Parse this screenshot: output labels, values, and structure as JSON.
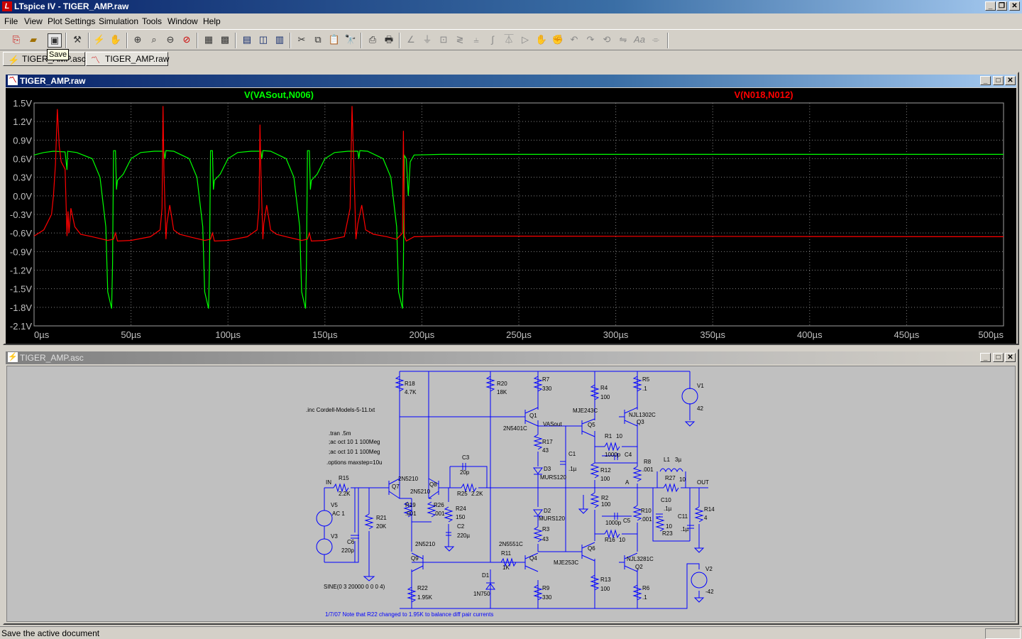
{
  "app": {
    "title": "LTspice IV - TIGER_AMP.raw"
  },
  "menu": [
    "File",
    "View",
    "Plot Settings",
    "Simulation",
    "Tools",
    "Window",
    "Help"
  ],
  "toolbar": {
    "tooltip": "Save",
    "icons": [
      "new-schematic-icon",
      "open-icon",
      "save-icon",
      "control-panel-icon",
      "run-icon",
      "halt-icon",
      "zoom-in-icon",
      "zoom-full-icon",
      "zoom-out-icon",
      "zoom-cancel-icon",
      "autorange-icon",
      "delete-trace-icon",
      "tile-vertical-icon",
      "cascade-icon",
      "tile-horizontal-icon",
      "cut-icon",
      "copy-icon",
      "paste-icon",
      "find-icon",
      "print-preview-icon",
      "print-icon",
      "wire-icon",
      "ground-icon",
      "label-net-icon",
      "resistor-icon",
      "capacitor-icon",
      "inductor-icon",
      "diode-icon",
      "component-icon",
      "move-icon",
      "drag-icon",
      "undo-icon",
      "redo-icon",
      "rotate-icon",
      "mirror-icon",
      "text-icon",
      "spice-directive-icon"
    ]
  },
  "tabs": [
    {
      "label": "TIGER_AMP.asc",
      "icon": "schematic-icon"
    },
    {
      "label": "TIGER_AMP.raw",
      "icon": "waveform-icon"
    }
  ],
  "plot_window": {
    "title": "TIGER_AMP.raw"
  },
  "schematic_window": {
    "title": "TIGER_AMP.asc"
  },
  "status": {
    "text": "Save the active document"
  },
  "colors": {
    "trace1": "#00ff00",
    "trace2": "#ff0000",
    "grid": "#808080",
    "background": "#000000",
    "wire": "#0000ff"
  },
  "chart_data": {
    "type": "line",
    "title": "",
    "xlabel": "",
    "ylabel": "",
    "x_ticks": [
      "0µs",
      "50µs",
      "100µs",
      "150µs",
      "200µs",
      "250µs",
      "300µs",
      "350µs",
      "400µs",
      "450µs",
      "500µs"
    ],
    "y_ticks": [
      "1.5V",
      "1.2V",
      "0.9V",
      "0.6V",
      "0.3V",
      "0.0V",
      "-0.3V",
      "-0.6V",
      "-0.9V",
      "-1.2V",
      "-1.5V",
      "-1.8V",
      "-2.1V"
    ],
    "xlim": [
      0,
      500
    ],
    "ylim": [
      -2.1,
      1.5
    ],
    "grid": true,
    "series": [
      {
        "name": "V(VASout,N006)",
        "color": "#00ff00",
        "points": [
          [
            0,
            0.66
          ],
          [
            5,
            0.7
          ],
          [
            10,
            0.72
          ],
          [
            16,
            0.71
          ],
          [
            17,
            0.42
          ],
          [
            17.3,
            0.72
          ],
          [
            22,
            0.7
          ],
          [
            30,
            0.6
          ],
          [
            34,
            0.3
          ],
          [
            37,
            -0.5
          ],
          [
            38,
            -1.55
          ],
          [
            40,
            -1.82
          ],
          [
            40.5,
            -1.1
          ],
          [
            41,
            0.73
          ],
          [
            42,
            0.73
          ],
          [
            42.5,
            0.1
          ],
          [
            43,
            0.25
          ],
          [
            46,
            0.35
          ],
          [
            50,
            0.6
          ],
          [
            55,
            0.7
          ],
          [
            62,
            0.72
          ],
          [
            67,
            0.72
          ],
          [
            67.5,
            0.6
          ],
          [
            68,
            0.73
          ],
          [
            72,
            0.72
          ],
          [
            80,
            0.6
          ],
          [
            84,
            0.3
          ],
          [
            87,
            -0.5
          ],
          [
            88,
            -1.55
          ],
          [
            90,
            -1.82
          ],
          [
            90.5,
            -1.1
          ],
          [
            91,
            0.73
          ],
          [
            92,
            0.73
          ],
          [
            92.5,
            0.1
          ],
          [
            93,
            0.25
          ],
          [
            96,
            0.35
          ],
          [
            100,
            0.6
          ],
          [
            105,
            0.7
          ],
          [
            112,
            0.72
          ],
          [
            117,
            0.72
          ],
          [
            117.5,
            0.6
          ],
          [
            118,
            0.73
          ],
          [
            122,
            0.72
          ],
          [
            130,
            0.6
          ],
          [
            134,
            0.3
          ],
          [
            137,
            -0.5
          ],
          [
            138,
            -1.55
          ],
          [
            140,
            -1.82
          ],
          [
            140.5,
            -1.1
          ],
          [
            141,
            0.73
          ],
          [
            142,
            0.73
          ],
          [
            142.5,
            0.1
          ],
          [
            143,
            0.25
          ],
          [
            146,
            0.35
          ],
          [
            150,
            0.6
          ],
          [
            155,
            0.7
          ],
          [
            162,
            0.72
          ],
          [
            167,
            0.72
          ],
          [
            167.5,
            0.6
          ],
          [
            168,
            0.73
          ],
          [
            172,
            0.72
          ],
          [
            180,
            0.6
          ],
          [
            184,
            0.3
          ],
          [
            187,
            -0.5
          ],
          [
            188,
            -1.55
          ],
          [
            190,
            -1.82
          ],
          [
            190.5,
            -1.1
          ],
          [
            191,
            0.65
          ],
          [
            192,
            0.6
          ],
          [
            193,
            0.0
          ],
          [
            194,
            0.55
          ],
          [
            196,
            0.66
          ],
          [
            210,
            0.67
          ],
          [
            500,
            0.67
          ]
        ]
      },
      {
        "name": "V(N018,N012)",
        "color": "#ff0000",
        "points": [
          [
            0,
            -0.65
          ],
          [
            5,
            -0.55
          ],
          [
            9,
            -0.3
          ],
          [
            10,
            0.0
          ],
          [
            11,
            0.5
          ],
          [
            12,
            1.4
          ],
          [
            13,
            0.8
          ],
          [
            14,
            0.55
          ],
          [
            16,
            0.43
          ],
          [
            17,
            -0.65
          ],
          [
            17.5,
            -0.25
          ],
          [
            18,
            -0.6
          ],
          [
            19,
            -0.2
          ],
          [
            21,
            -0.5
          ],
          [
            24,
            -0.62
          ],
          [
            30,
            -0.66
          ],
          [
            38,
            -0.72
          ],
          [
            41,
            -0.7
          ],
          [
            42,
            -0.6
          ],
          [
            43,
            -0.73
          ],
          [
            50,
            -0.72
          ],
          [
            60,
            -0.66
          ],
          [
            65,
            -0.55
          ],
          [
            66,
            -0.2
          ],
          [
            66.5,
            1.45
          ],
          [
            67,
            0.4
          ],
          [
            68,
            -0.7
          ],
          [
            68.5,
            -0.45
          ],
          [
            70,
            -0.15
          ],
          [
            72,
            -0.55
          ],
          [
            75,
            -0.62
          ],
          [
            80,
            -0.66
          ],
          [
            88,
            -0.72
          ],
          [
            91,
            -0.7
          ],
          [
            92,
            -0.6
          ],
          [
            93,
            -0.73
          ],
          [
            100,
            -0.72
          ],
          [
            110,
            -0.66
          ],
          [
            115,
            -0.55
          ],
          [
            116,
            -0.2
          ],
          [
            116.5,
            1.15
          ],
          [
            117,
            0.4
          ],
          [
            118,
            -0.7
          ],
          [
            118.5,
            -0.45
          ],
          [
            120,
            -0.15
          ],
          [
            122,
            -0.55
          ],
          [
            125,
            -0.62
          ],
          [
            130,
            -0.66
          ],
          [
            138,
            -0.72
          ],
          [
            141,
            -0.7
          ],
          [
            142,
            -0.6
          ],
          [
            143,
            -0.73
          ],
          [
            150,
            -0.72
          ],
          [
            160,
            -0.66
          ],
          [
            163,
            -0.2
          ],
          [
            164,
            1.45
          ],
          [
            165,
            0.4
          ],
          [
            166,
            -0.7
          ],
          [
            167,
            -0.45
          ],
          [
            169,
            -0.15
          ],
          [
            171,
            -0.55
          ],
          [
            175,
            -0.62
          ],
          [
            182,
            -0.66
          ],
          [
            187,
            -0.7
          ],
          [
            190,
            -0.6
          ],
          [
            190.5,
            1.05
          ],
          [
            191,
            -0.65
          ],
          [
            192,
            -0.73
          ],
          [
            196,
            -0.66
          ],
          [
            210,
            -0.65
          ],
          [
            500,
            -0.66
          ]
        ]
      }
    ]
  },
  "schematic": {
    "directives": [
      ".inc Cordell-Models-5-11.txt",
      ".tran .5m",
      ";ac oct 10 1 100Meg",
      ";ac oct 10 1 100Meg",
      ".options maxstep=10u"
    ],
    "source_expr": "SINE(0 3 20000 0 0 0 4)",
    "note": "1/7/07  Note that R22 changed to 1.95K to balance diff pair currents",
    "labels": [
      [
        "R18",
        570,
        541
      ],
      [
        "4.7K",
        570,
        553
      ],
      [
        "R20",
        700,
        541
      ],
      [
        "18K",
        700,
        553
      ],
      [
        "R7",
        764,
        535
      ],
      [
        "330",
        764,
        548
      ],
      [
        "R4",
        846,
        547
      ],
      [
        "100",
        846,
        560
      ],
      [
        "R5",
        905,
        535
      ],
      [
        ".1",
        905,
        548
      ],
      [
        "V1",
        982,
        544
      ],
      [
        "42",
        982,
        576
      ],
      [
        "Q1",
        746,
        586
      ],
      [
        "2N5401C",
        709,
        604
      ],
      [
        "VASout",
        765,
        598
      ],
      [
        "MJE243C",
        807,
        579
      ],
      [
        "Q5",
        828,
        599
      ],
      [
        "NJL1302C",
        886,
        585
      ],
      [
        "Q3",
        897,
        595
      ],
      [
        "R1",
        852,
        615
      ],
      [
        "10",
        868,
        615
      ],
      [
        "R17",
        764,
        623
      ],
      [
        "43",
        764,
        635
      ],
      [
        "C1",
        801,
        640
      ],
      [
        ".1µ",
        801,
        661
      ],
      [
        "1000p",
        852,
        641
      ],
      [
        "C4",
        880,
        641
      ],
      [
        "R8",
        907,
        651
      ],
      [
        ".001",
        905,
        662
      ],
      [
        "D3",
        766,
        661
      ],
      [
        "MURS120",
        761,
        673
      ],
      [
        "R12",
        846,
        663
      ],
      [
        "100",
        846,
        675
      ],
      [
        "A",
        881,
        680
      ],
      [
        "C3",
        651,
        645
      ],
      [
        "20p",
        648,
        666
      ],
      [
        "L1",
        935,
        648
      ],
      [
        "3µ",
        951,
        648
      ],
      [
        "R27",
        937,
        674
      ],
      [
        "10",
        957,
        676
      ],
      [
        "OUT",
        982,
        680
      ],
      [
        "IN",
        459,
        680
      ],
      [
        "R15",
        477,
        674
      ],
      [
        "2.2K",
        477,
        696
      ],
      [
        "2N5210",
        561,
        675
      ],
      [
        "Q7",
        552,
        686
      ],
      [
        "2N5210",
        578,
        693
      ],
      [
        "Q8",
        605,
        683
      ],
      [
        "R25",
        644,
        696
      ],
      [
        "2.2K",
        664,
        696
      ],
      [
        "R2",
        847,
        702
      ],
      [
        "100",
        847,
        711
      ],
      [
        "C10",
        931,
        705
      ],
      [
        ".1µ",
        935,
        717
      ],
      [
        "R14",
        992,
        718
      ],
      [
        "4",
        992,
        730
      ],
      [
        "V5",
        466,
        712
      ],
      [
        "AC 1",
        468,
        724
      ],
      [
        "R19",
        571,
        712
      ],
      [
        ".001",
        571,
        724
      ],
      [
        "R26",
        611,
        712
      ],
      [
        ".001",
        611,
        724
      ],
      [
        "R24",
        642,
        717
      ],
      [
        "150",
        642,
        729
      ],
      [
        "D2",
        766,
        720
      ],
      [
        "MURS120",
        759,
        731
      ],
      [
        "R10",
        903,
        720
      ],
      [
        ".001",
        903,
        732
      ],
      [
        "C5",
        878,
        734
      ],
      [
        "1000p",
        853,
        737
      ],
      [
        "C11",
        955,
        728
      ],
      [
        ".1µ",
        959,
        746
      ],
      [
        "R21",
        530,
        730
      ],
      [
        "20K",
        530,
        742
      ],
      [
        "C2",
        644,
        742
      ],
      [
        "220µ",
        644,
        755
      ],
      [
        "R3",
        764,
        746
      ],
      [
        "43",
        764,
        760
      ],
      [
        "R16",
        852,
        761
      ],
      [
        "10",
        872,
        761
      ],
      [
        "R23",
        933,
        752
      ],
      [
        "V3",
        466,
        756
      ],
      [
        "C6",
        489,
        764
      ],
      [
        "220p",
        481,
        776
      ],
      [
        "2N5210",
        585,
        767
      ],
      [
        "2N5551C",
        703,
        767
      ],
      [
        "R11",
        706,
        780
      ],
      [
        "1K",
        708,
        800
      ],
      [
        "Q4",
        746,
        787
      ],
      [
        "MJE253C",
        780,
        793
      ],
      [
        "Q6",
        828,
        773
      ],
      [
        "NJL3281C",
        883,
        788
      ],
      [
        "Q2",
        895,
        799
      ],
      [
        "V2",
        994,
        802
      ],
      [
        "-42",
        994,
        834
      ],
      [
        "Q9",
        579,
        787
      ],
      [
        "D1",
        679,
        811
      ],
      [
        "R13",
        846,
        817
      ],
      [
        "100",
        846,
        830
      ],
      [
        "R22",
        588,
        829
      ],
      [
        "1.95K",
        588,
        842
      ],
      [
        "1N750",
        667,
        837
      ],
      [
        "R9",
        764,
        829
      ],
      [
        "330",
        764,
        842
      ],
      [
        "R6",
        905,
        829
      ],
      [
        ".1",
        905,
        842
      ],
      [
        "10",
        938,
        742
      ]
    ]
  }
}
